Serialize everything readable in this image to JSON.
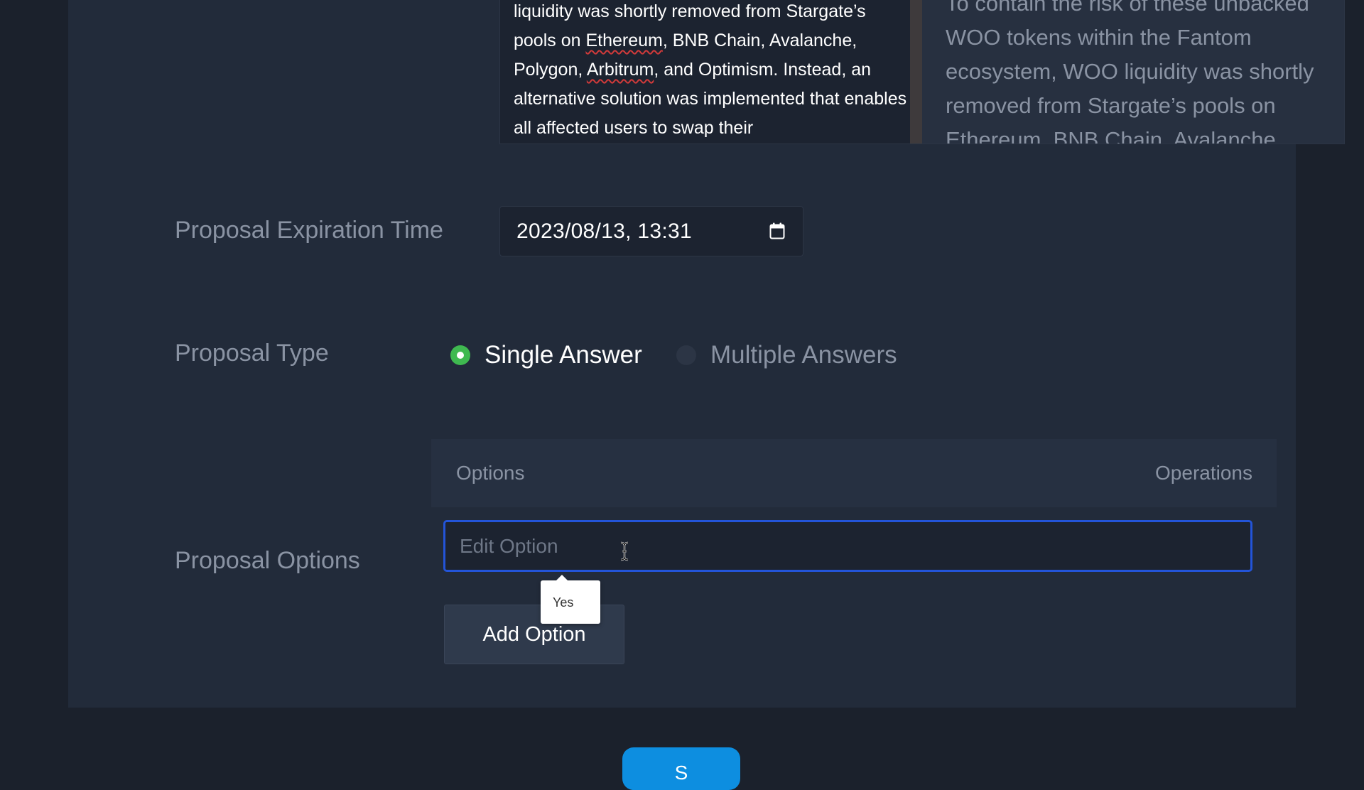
{
  "description": {
    "editor_text_parts": [
      "liquidity was shortly removed from Stargate’s pools on ",
      "Ethereum",
      ", BNB Chain, Avalanche, Polygon, ",
      "Arbitrum",
      ", and Optimism. Instead, an alternative solution was implemented that enables all affected users to swap their"
    ],
    "preview_text": "To contain the risk of these unbacked WOO tokens within the Fantom ecosystem, WOO liquidity was shortly removed from Stargate’s pools on Ethereum, BNB Chain, Avalanche"
  },
  "expiration": {
    "label": "Proposal Expiration Time",
    "value": "2023/08/13, 13:31",
    "icon": "calendar-icon"
  },
  "proposal_type": {
    "label": "Proposal Type",
    "options": [
      {
        "label": "Single Answer",
        "selected": true
      },
      {
        "label": "Multiple Answers",
        "selected": false
      }
    ],
    "selected_color": "#3fb950"
  },
  "proposal_options": {
    "label": "Proposal Options",
    "columns": {
      "options": "Options",
      "operations": "Operations"
    },
    "edit_placeholder": "Edit Option",
    "edit_value": "",
    "tooltip": "Yes",
    "add_button": "Add Option"
  },
  "submit": {
    "label": "S"
  },
  "colors": {
    "page_bg": "#1b212c",
    "panel_bg": "#222b3a",
    "focus_border": "#2354d8",
    "primary_button": "#0d8ee0"
  }
}
